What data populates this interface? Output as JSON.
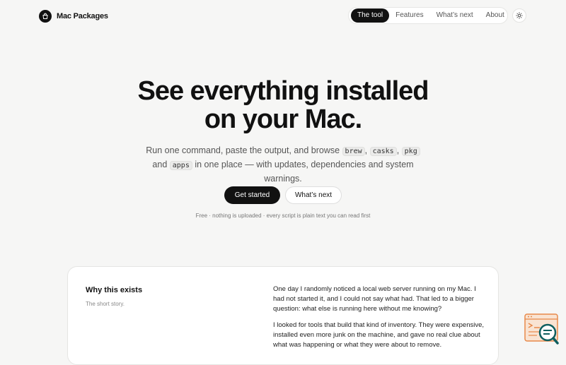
{
  "header": {
    "brand_name": "Mac Packages",
    "nav": [
      "The tool",
      "Features",
      "What’s next",
      "About"
    ],
    "active_tab": "The tool"
  },
  "hero": {
    "title_line1": "See everything installed",
    "title_line2": "on your Mac.",
    "sub_part1": "Run one command, paste the output, and browse",
    "code1": "brew",
    "code2": "casks",
    "code3": "pkg",
    "sub_and": "and",
    "code4": "apps",
    "sub_part2": "in one place — with updates, dependencies and system warnings.",
    "primary_button": "Get started",
    "secondary_button": "What’s next",
    "note": "Free · nothing is uploaded · every script is plain text you can read first"
  },
  "card": {
    "title": "Why this exists",
    "subtitle": "The short story.",
    "para1": "One day I randomly noticed a local web server running on my Mac. I had not started it, and I could not say what had. That led to a bigger question: what else is running here without me knowing?",
    "para2": "I looked for tools that build that kind of inventory. They were expensive, installed even more junk on the machine, and gave no real clue about what was happening or what they were about to remove."
  },
  "colors": {
    "accent": "#111111",
    "widget_orange": "#e8894a",
    "widget_teal": "#0f5f5f"
  }
}
